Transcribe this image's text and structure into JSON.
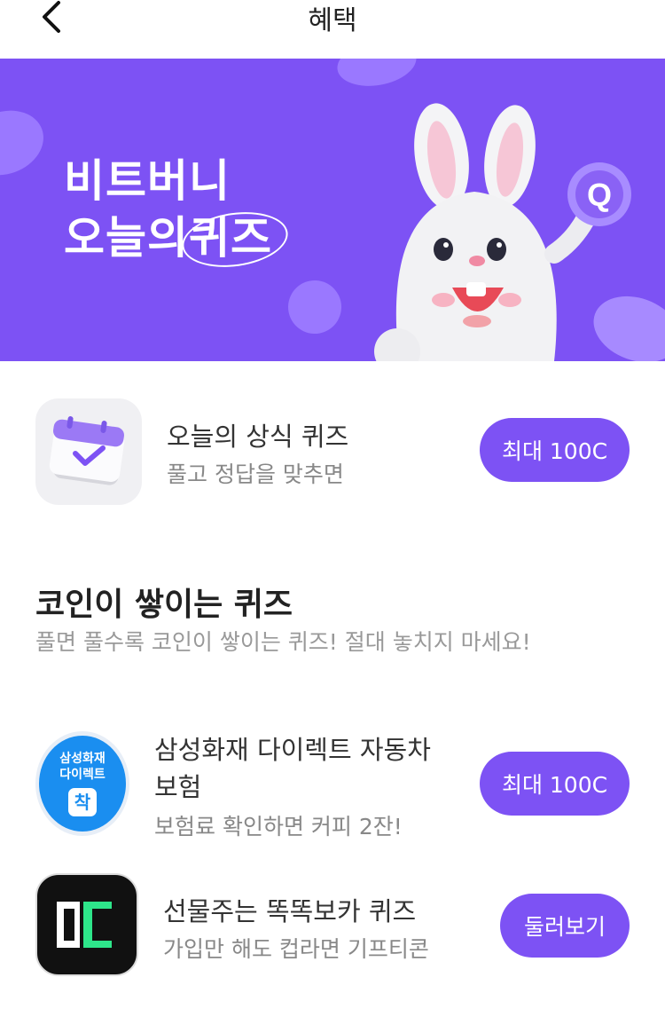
{
  "header": {
    "title": "혜택"
  },
  "banner": {
    "line1": "비트버니",
    "line2_prefix": "오늘의",
    "line2_highlight": "퀴즈",
    "mascot_badge": "Q"
  },
  "today_quiz": {
    "title": "오늘의 상식 퀴즈",
    "subtitle": "풀고 정답을 맞추면",
    "button": "최대 100C"
  },
  "section": {
    "title": "코인이 쌓이는 퀴즈",
    "subtitle": "풀면 풀수록 코인이 쌓이는 퀴즈! 절대 놓치지 마세요!"
  },
  "quizzes": [
    {
      "icon_text1": "삼성화재",
      "icon_text2": "다이렉트",
      "icon_text3": "착",
      "title_line1": "삼성화재 다이렉트 자동차",
      "title_line2": "보험",
      "subtitle": "보험료 확인하면 커피 2잔!",
      "button": "최대 100C"
    },
    {
      "title": "선물주는 똑똑보카 퀴즈",
      "subtitle": "가입만 해도 컵라면 기프티콘",
      "button": "둘러보기"
    }
  ],
  "colors": {
    "accent": "#7d52f4",
    "samsung_blue": "#1a8ef0"
  }
}
